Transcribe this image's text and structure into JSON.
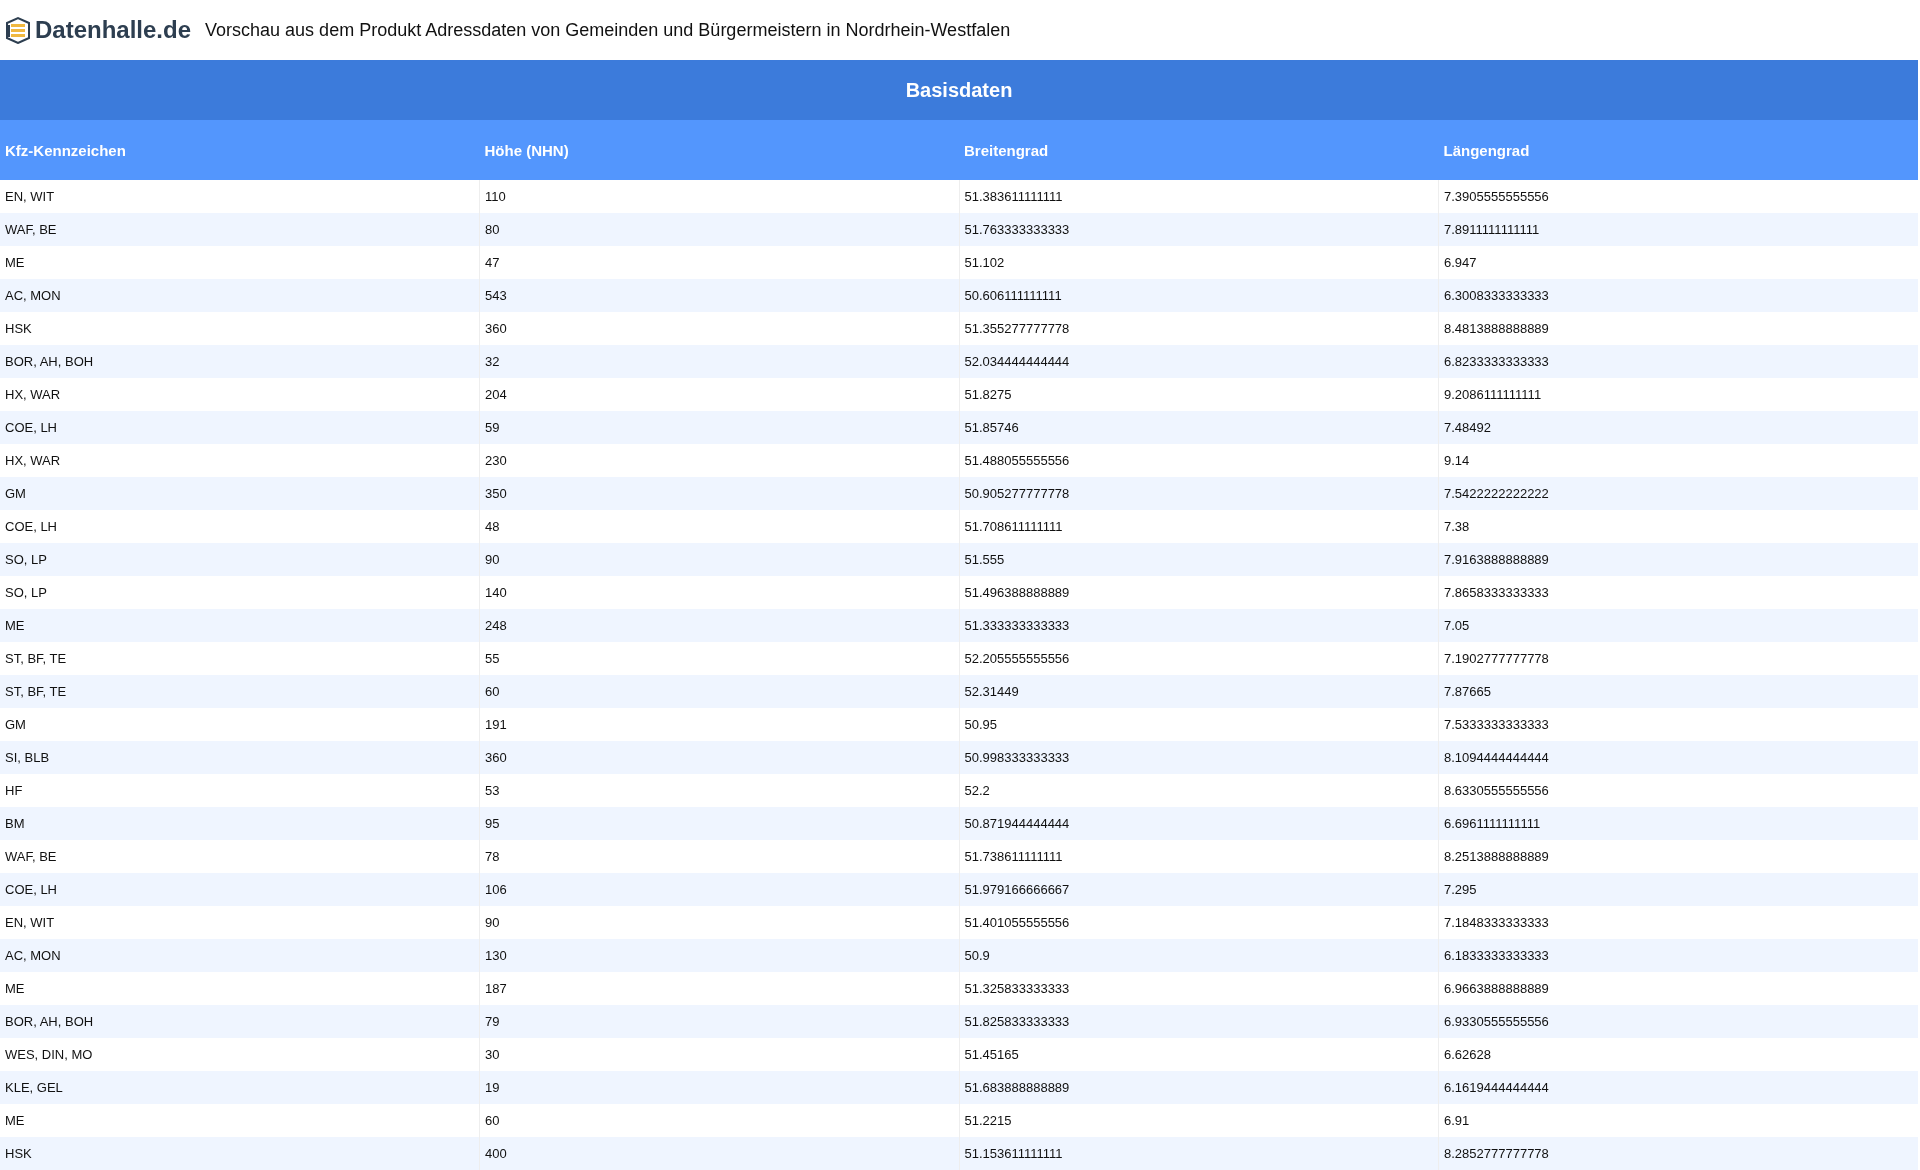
{
  "header": {
    "logo_text": "Datenhalle.de",
    "title": "Vorschau aus dem Produkt Adressdaten von Gemeinden und Bürgermeistern in Nordrhein-Westfalen"
  },
  "table": {
    "section_title": "Basisdaten",
    "columns": [
      "Kfz-Kennzeichen",
      "Höhe (NHN)",
      "Breitengrad",
      "Längengrad"
    ],
    "rows": [
      [
        "EN, WIT",
        "110",
        "51.383611111111",
        "7.3905555555556"
      ],
      [
        "WAF, BE",
        "80",
        "51.763333333333",
        "7.8911111111111"
      ],
      [
        "ME",
        "47",
        "51.102",
        "6.947"
      ],
      [
        "AC, MON",
        "543",
        "50.606111111111",
        "6.3008333333333"
      ],
      [
        "HSK",
        "360",
        "51.355277777778",
        "8.4813888888889"
      ],
      [
        "BOR, AH, BOH",
        "32",
        "52.034444444444",
        "6.8233333333333"
      ],
      [
        "HX, WAR",
        "204",
        "51.8275",
        "9.2086111111111"
      ],
      [
        "COE, LH",
        "59",
        "51.85746",
        "7.48492"
      ],
      [
        "HX, WAR",
        "230",
        "51.488055555556",
        "9.14"
      ],
      [
        "GM",
        "350",
        "50.905277777778",
        "7.5422222222222"
      ],
      [
        "COE, LH",
        "48",
        "51.708611111111",
        "7.38"
      ],
      [
        "SO, LP",
        "90",
        "51.555",
        "7.9163888888889"
      ],
      [
        "SO, LP",
        "140",
        "51.496388888889",
        "7.8658333333333"
      ],
      [
        "ME",
        "248",
        "51.333333333333",
        "7.05"
      ],
      [
        "ST, BF, TE",
        "55",
        "52.205555555556",
        "7.1902777777778"
      ],
      [
        "ST, BF, TE",
        "60",
        "52.31449",
        "7.87665"
      ],
      [
        "GM",
        "191",
        "50.95",
        "7.5333333333333"
      ],
      [
        "SI, BLB",
        "360",
        "50.998333333333",
        "8.1094444444444"
      ],
      [
        "HF",
        "53",
        "52.2",
        "8.6330555555556"
      ],
      [
        "BM",
        "95",
        "50.871944444444",
        "6.6961111111111"
      ],
      [
        "WAF, BE",
        "78",
        "51.738611111111",
        "8.2513888888889"
      ],
      [
        "COE, LH",
        "106",
        "51.979166666667",
        "7.295"
      ],
      [
        "EN, WIT",
        "90",
        "51.401055555556",
        "7.1848333333333"
      ],
      [
        "AC, MON",
        "130",
        "50.9",
        "6.1833333333333"
      ],
      [
        "ME",
        "187",
        "51.325833333333",
        "6.9663888888889"
      ],
      [
        "BOR, AH, BOH",
        "79",
        "51.825833333333",
        "6.9330555555556"
      ],
      [
        "WES, DIN, MO",
        "30",
        "51.45165",
        "6.62628"
      ],
      [
        "KLE, GEL",
        "19",
        "51.683888888889",
        "6.1619444444444"
      ],
      [
        "ME",
        "60",
        "51.2215",
        "6.91"
      ],
      [
        "HSK",
        "400",
        "51.153611111111",
        "8.2852777777778"
      ]
    ]
  }
}
